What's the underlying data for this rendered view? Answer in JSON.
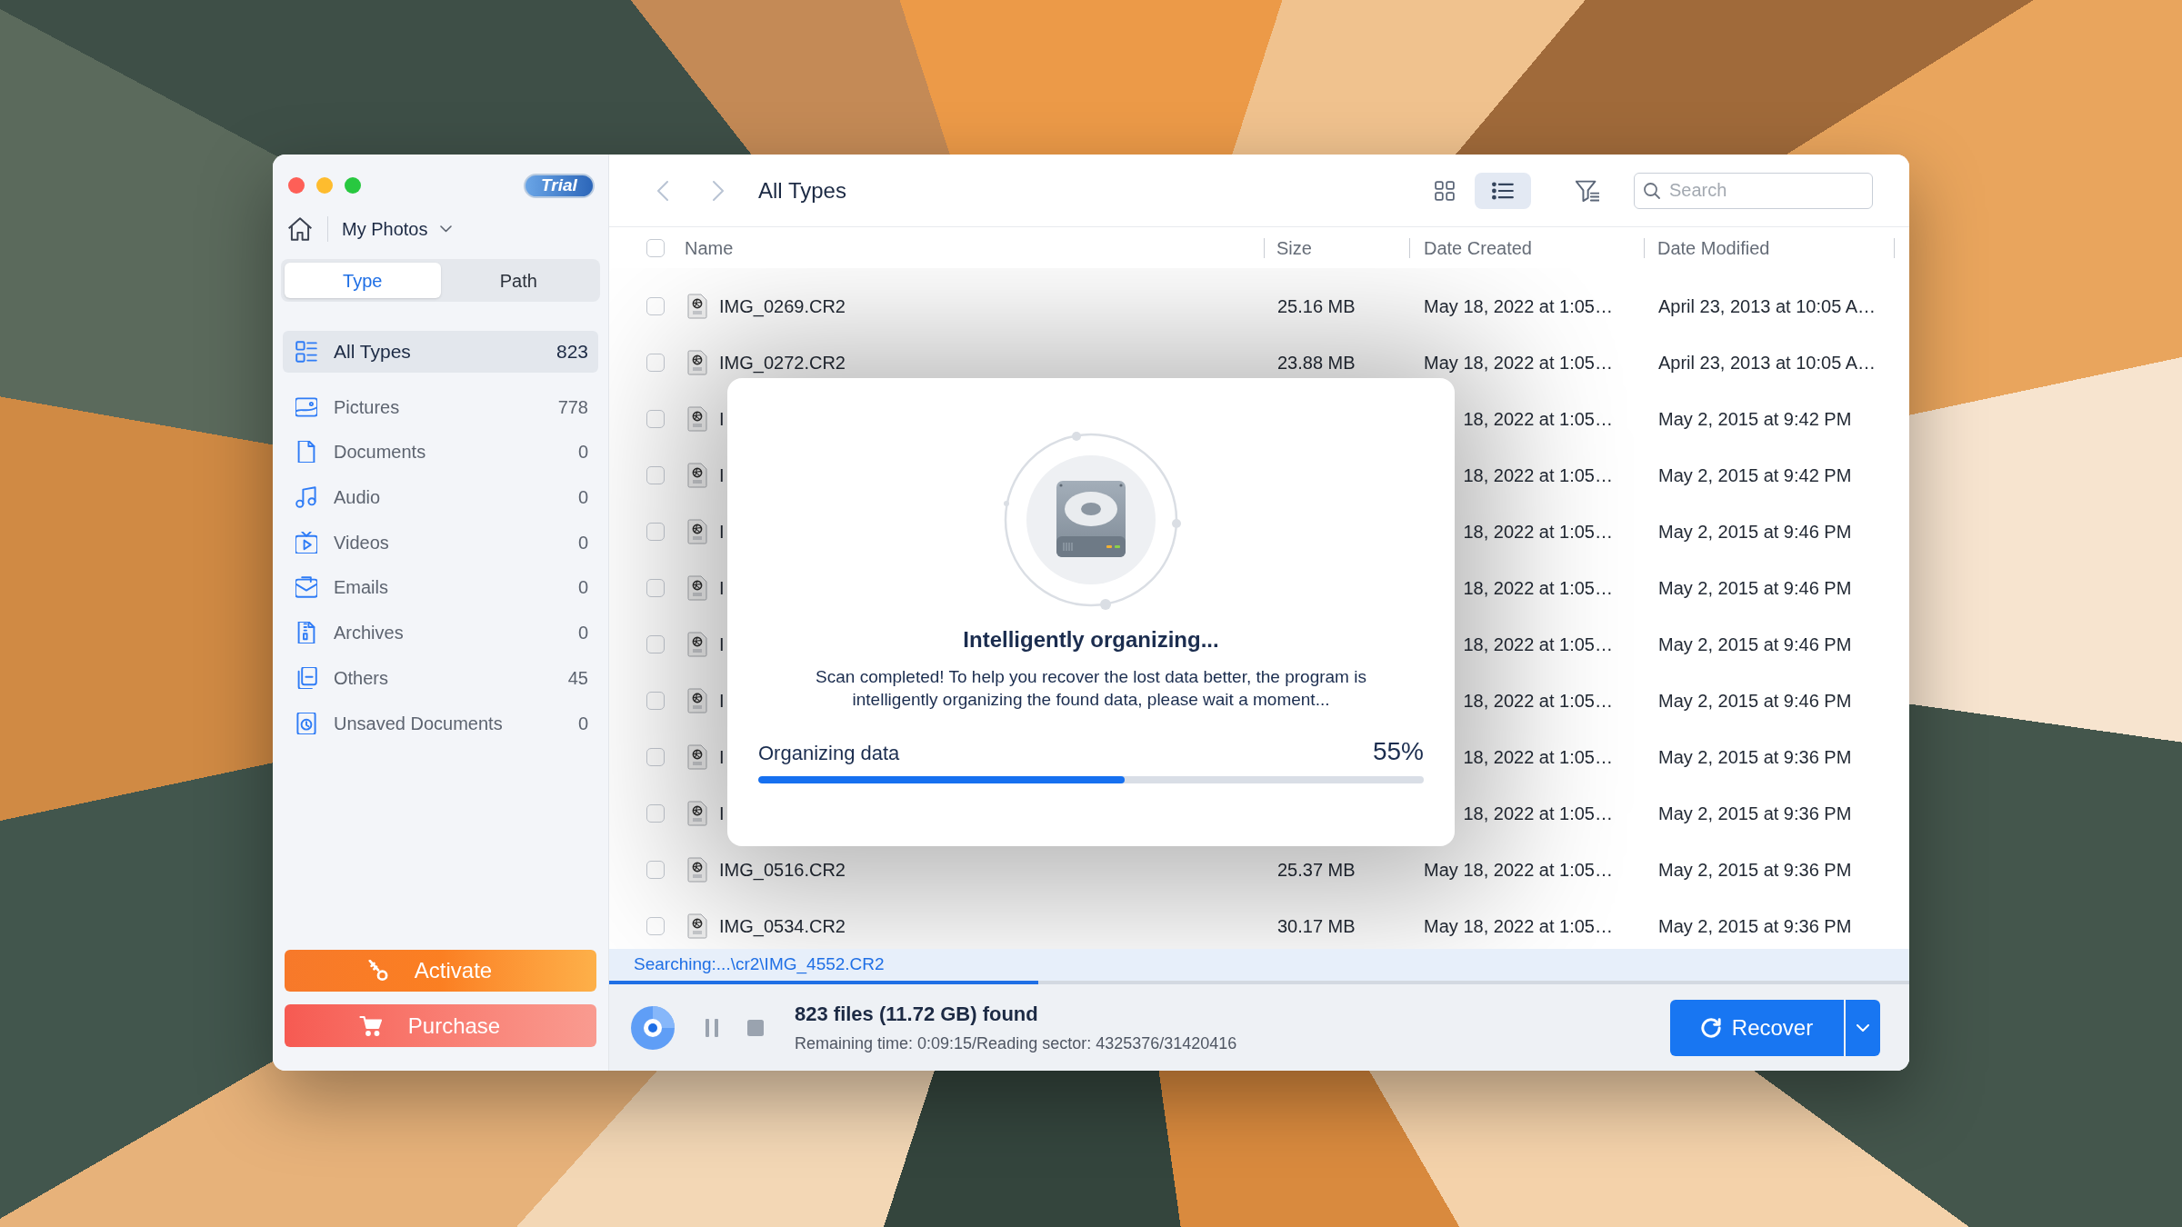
{
  "window": {
    "badge": "Trial"
  },
  "sidebar": {
    "location": "My Photos",
    "tabs": [
      {
        "label": "Type",
        "selected": true
      },
      {
        "label": "Path",
        "selected": false
      }
    ],
    "items": [
      {
        "label": "All Types",
        "count": "823",
        "selected": true
      },
      {
        "label": "Pictures",
        "count": "778",
        "selected": false
      },
      {
        "label": "Documents",
        "count": "0",
        "selected": false
      },
      {
        "label": "Audio",
        "count": "0",
        "selected": false
      },
      {
        "label": "Videos",
        "count": "0",
        "selected": false
      },
      {
        "label": "Emails",
        "count": "0",
        "selected": false
      },
      {
        "label": "Archives",
        "count": "0",
        "selected": false
      },
      {
        "label": "Others",
        "count": "45",
        "selected": false
      },
      {
        "label": "Unsaved Documents",
        "count": "0",
        "selected": false
      }
    ],
    "buttons": [
      {
        "kind": "activate",
        "label": "Activate"
      },
      {
        "kind": "purchase",
        "label": "Purchase"
      }
    ]
  },
  "toolbar": {
    "title": "All Types",
    "view_modes": [
      {
        "selected": false
      },
      {
        "selected": true
      }
    ],
    "search": {
      "placeholder": "Search"
    }
  },
  "table": {
    "select_all": {
      "checked": false
    },
    "columns": [
      "Name",
      "Size",
      "Date Created",
      "Date Modified"
    ],
    "rows": [
      {
        "checked": false,
        "name": "IMG_0269.CR2",
        "size": "25.16 MB",
        "date_created": "May 18, 2022 at 1:05…",
        "date_modified": "April 23, 2013 at 10:05 A…"
      },
      {
        "checked": false,
        "name": "IMG_0272.CR2",
        "size": "23.88 MB",
        "date_created": "May 18, 2022 at 1:05…",
        "date_modified": "April 23, 2013 at 10:05 A…"
      },
      {
        "checked": false,
        "name": "I",
        "date_created": "18, 2022 at 1:05…",
        "date_modified": "May 2, 2015 at 9:42 PM"
      },
      {
        "checked": false,
        "name": "I",
        "date_created": "18, 2022 at 1:05…",
        "date_modified": "May 2, 2015 at 9:42 PM"
      },
      {
        "checked": false,
        "name": "I",
        "date_created": "18, 2022 at 1:05…",
        "date_modified": "May 2, 2015 at 9:46 PM"
      },
      {
        "checked": false,
        "name": "I",
        "date_created": "18, 2022 at 1:05…",
        "date_modified": "May 2, 2015 at 9:46 PM"
      },
      {
        "checked": false,
        "name": "I",
        "date_created": "18, 2022 at 1:05…",
        "date_modified": "May 2, 2015 at 9:46 PM"
      },
      {
        "checked": false,
        "name": "I",
        "date_created": "18, 2022 at 1:05…",
        "date_modified": "May 2, 2015 at 9:46 PM"
      },
      {
        "checked": false,
        "name": "I",
        "date_created": "18, 2022 at 1:05…",
        "date_modified": "May 2, 2015 at 9:36 PM"
      },
      {
        "checked": false,
        "name": "I",
        "date_created": "18, 2022 at 1:05…",
        "date_modified": "May 2, 2015 at 9:36 PM"
      },
      {
        "checked": false,
        "name": "IMG_0516.CR2",
        "size": "25.37 MB",
        "date_created": "May 18, 2022 at 1:05…",
        "date_modified": "May 2, 2015 at 9:36 PM"
      },
      {
        "checked": false,
        "name": "IMG_0534.CR2",
        "size": "30.17 MB",
        "date_created": "May 18, 2022 at 1:05…",
        "date_modified": "May 2, 2015 at 9:36 PM"
      }
    ]
  },
  "scan": {
    "current_path": "Searching:...\\cr2\\IMG_4552.CR2",
    "level": 0.33,
    "summary": "823 files (11.72 GB) found",
    "detail": "Remaining time: 0:09:15/Reading sector: 4325376/31420416"
  },
  "recover_button": {
    "label": "Recover"
  },
  "dialog": {
    "title": "Intelligently organizing...",
    "message": "Scan completed! To help you recover the lost data better, the program is intelligently organizing the found data, please wait a moment...",
    "progress_label": "Organizing data",
    "percent": "55%",
    "level": 0.55
  }
}
